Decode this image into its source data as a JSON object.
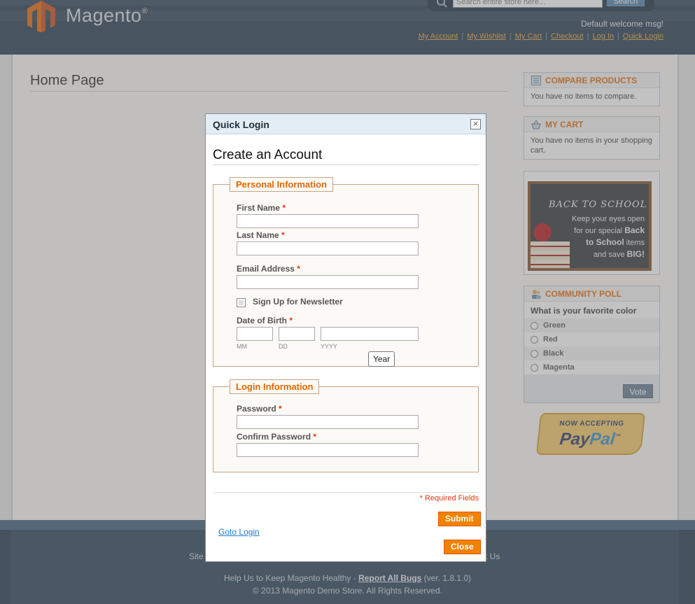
{
  "header": {
    "logo_text": "Magento",
    "logo_reg": "®",
    "search_placeholder": "Search entire store here...",
    "search_button": "Search",
    "welcome": "Default welcome msg!",
    "links": [
      "My Account",
      "My Wishlist",
      "My Cart",
      "Checkout",
      "Log In",
      "Quick Login"
    ]
  },
  "main": {
    "page_title": "Home Page"
  },
  "sidebar": {
    "compare": {
      "title": "COMPARE PRODUCTS",
      "text": "You have no items to compare."
    },
    "cart": {
      "title": "MY CART",
      "text": "You have no items in your shopping cart."
    },
    "promo": {
      "heading": "BACK TO SCHOOL",
      "line1": "Keep your eyes open",
      "line2": "for our special",
      "bold1": "Back",
      "bold2": "to School",
      "line3": "items",
      "line4": "and save",
      "bold3": "BIG!"
    },
    "poll": {
      "title": "COMMUNITY POLL",
      "question": "What is your favorite color",
      "options": [
        "Green",
        "Red",
        "Black",
        "Magenta"
      ],
      "vote": "Vote"
    },
    "paypal": {
      "top": "NOW ACCEPTING",
      "pay": "Pay",
      "pal": "Pal",
      "tm": "™"
    }
  },
  "footer": {
    "link_left": "Site",
    "link_right": "t Us",
    "help_prefix": "Help Us to Keep Magento Healthy - ",
    "help_link": "Report All Bugs",
    "help_suffix": " (ver. 1.8.1.0)",
    "copyright": "© 2013 Magento Demo Store. All Rights Reserved."
  },
  "modal": {
    "title": "Quick Login",
    "close_glyph": "×",
    "heading": "Create an Account",
    "personal": {
      "legend": "Personal Information",
      "first_name": "First Name",
      "last_name": "Last Name",
      "email": "Email Address",
      "newsletter": "Sign Up for Newsletter",
      "dob": "Date of Birth",
      "mm": "MM",
      "dd": "DD",
      "yyyy": "YYYY",
      "tooltip": "Year"
    },
    "login": {
      "legend": "Login Information",
      "password": "Password",
      "confirm": "Confirm Password"
    },
    "required_mark": "*",
    "required_note": "* Required Fields",
    "submit": "Submit",
    "goto_login": "Goto Login",
    "close_button": "Close"
  }
}
